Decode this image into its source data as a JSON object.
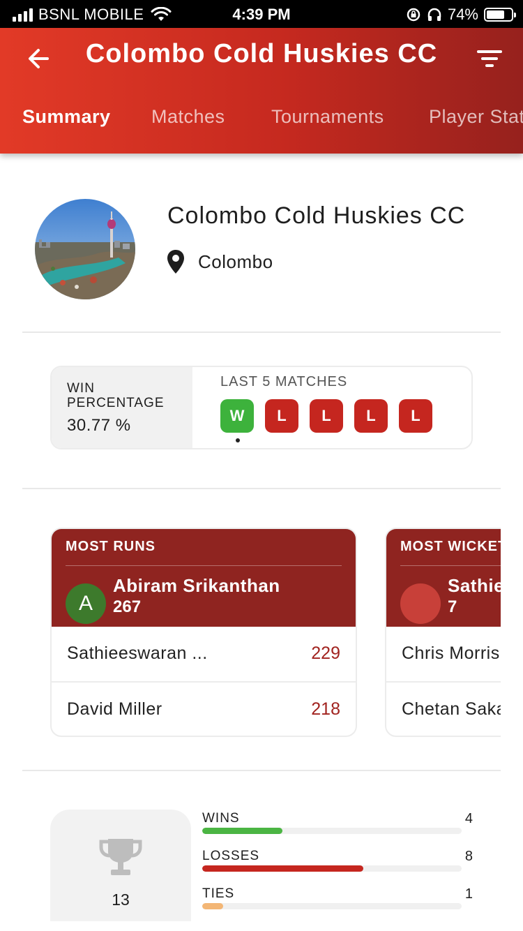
{
  "status_bar": {
    "carrier": "BSNL MOBILE",
    "time": "4:39 PM",
    "battery": "74%",
    "battery_level": 0.74
  },
  "header": {
    "title": "Colombo Cold Huskies CC",
    "back_icon": "arrow-left-icon",
    "filter_icon": "filter-icon",
    "tabs": [
      {
        "label": "Summary",
        "active": true
      },
      {
        "label": "Matches",
        "active": false
      },
      {
        "label": "Tournaments",
        "active": false
      },
      {
        "label": "Player Stats",
        "active": false
      }
    ]
  },
  "team": {
    "name": "Colombo Cold Huskies CC",
    "location": "Colombo",
    "location_icon": "map-pin-icon"
  },
  "win_card": {
    "label": "WIN PERCENTAGE",
    "value": "30.77 %",
    "last5_label": "LAST 5 MATCHES",
    "results": [
      "W",
      "L",
      "L",
      "L",
      "L"
    ]
  },
  "leaders": [
    {
      "title": "MOST RUNS",
      "top": {
        "initial": "A",
        "name": "Abiram Srikanthan",
        "value": "267",
        "avatar_color": "#3d7a2c"
      },
      "rows": [
        {
          "name": "Sathieeswaran ...",
          "value": "229"
        },
        {
          "name": "David Miller",
          "value": "218"
        }
      ]
    },
    {
      "title": "MOST WICKETS",
      "top": {
        "initial": "",
        "name": "Sathieeswaran",
        "value": "7",
        "avatar_color": "#c84039"
      },
      "rows": [
        {
          "name": "Chris Morris",
          "value": ""
        },
        {
          "name": "Chetan Sakariya",
          "value": ""
        }
      ]
    }
  ],
  "stats": {
    "total": "13",
    "trophy_icon": "trophy-icon",
    "items": [
      {
        "label": "WINS",
        "value": "4",
        "fraction": 0.31,
        "color": "#4bb543"
      },
      {
        "label": "LOSSES",
        "value": "8",
        "fraction": 0.62,
        "color": "#c5261f"
      },
      {
        "label": "TIES",
        "value": "1",
        "fraction": 0.08,
        "color": "#f3b675"
      }
    ]
  },
  "colors": {
    "header_start": "#e23a27",
    "header_end": "#96211d",
    "leader_header": "#8f2420",
    "win": "#3db23c",
    "loss": "#c5261f"
  }
}
